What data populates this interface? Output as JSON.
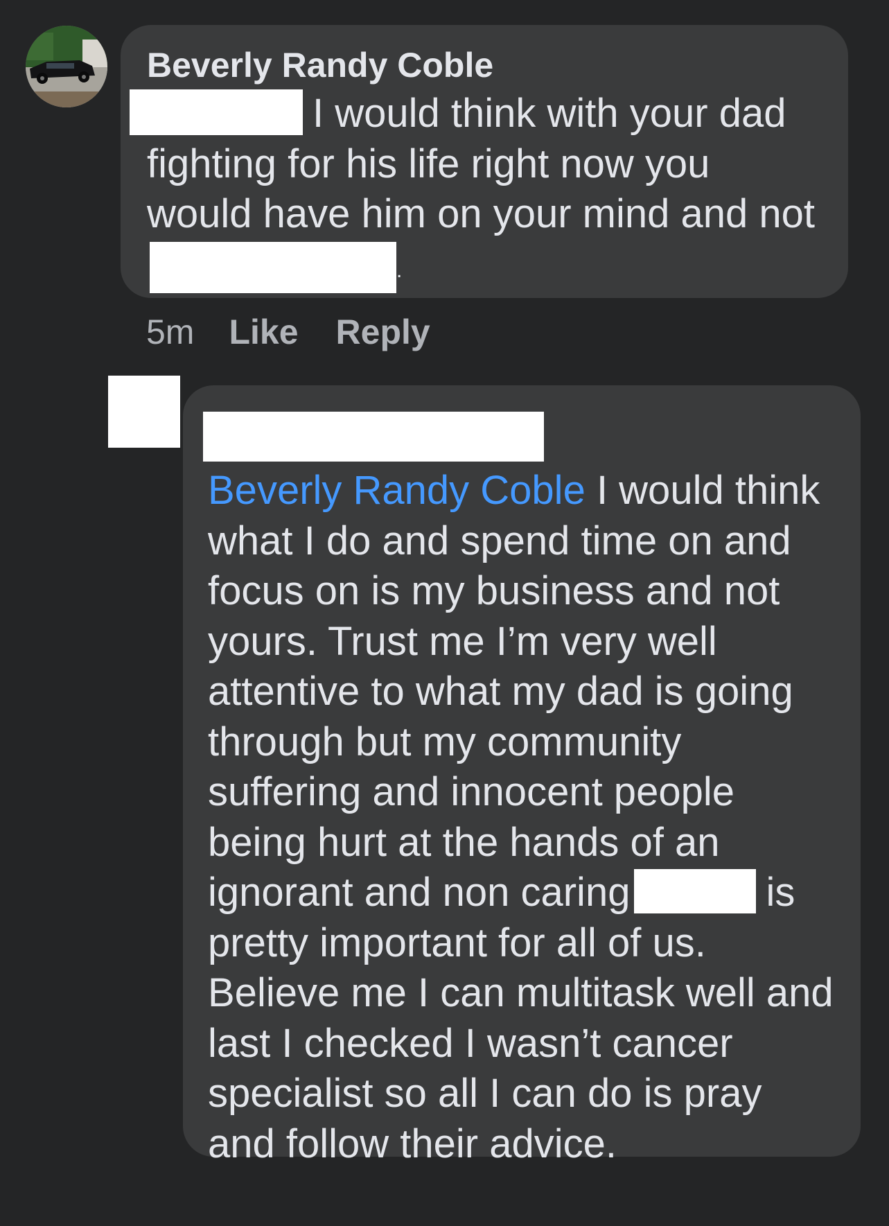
{
  "comment": {
    "author": "Beverly Randy Coble",
    "text_line1": "I would think with your dad",
    "text_line2": "fighting for his life right now you",
    "text_line3": "would have him on your mind and not",
    "text_end": ".",
    "time": "5m",
    "like_label": "Like",
    "reply_label": "Reply"
  },
  "reply": {
    "mention": "Beverly Randy Coble",
    "lines": [
      " I would think",
      "what I do and spend time on and",
      "focus on is my business and not",
      "yours. Trust me I’m very well",
      "attentive to what my dad is going",
      "through but my community",
      "suffering and innocent people",
      "being hurt at the hands of an",
      "ignorant and non caring"
    ],
    "after_redact": "is",
    "lines_after": [
      "pretty important for all of us.",
      "Believe me I can multitask well and",
      "last I checked I wasn’t cancer",
      "specialist so all I can do is pray",
      "and follow their advice."
    ]
  }
}
